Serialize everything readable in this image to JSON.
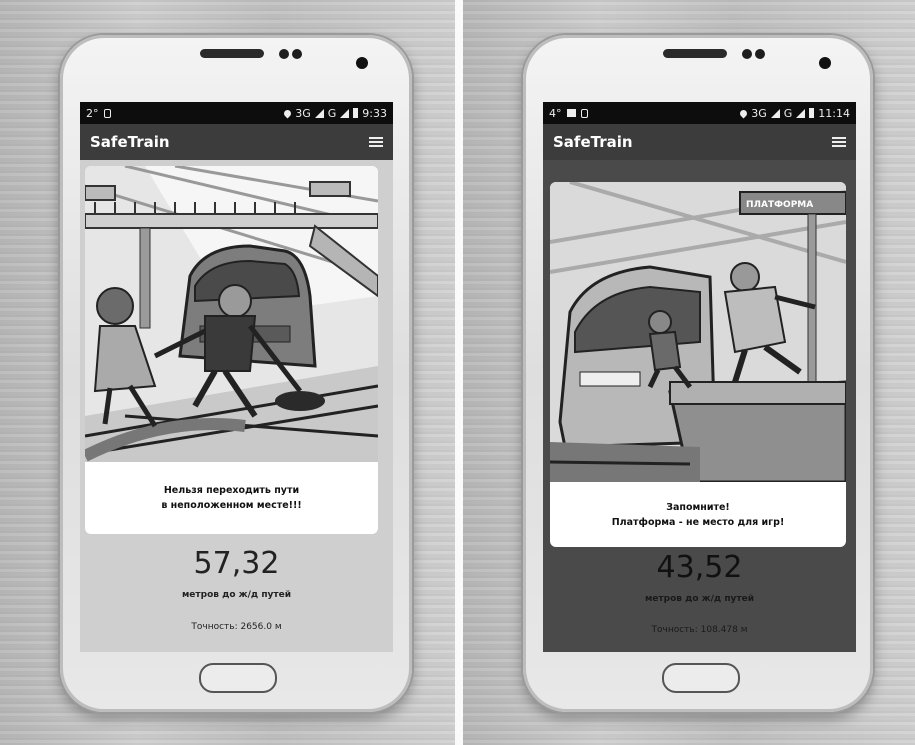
{
  "screens": [
    {
      "status": {
        "temp": "2°",
        "network": "3G",
        "signal": "G",
        "time": "9:33"
      },
      "app_title": "SafeTrain",
      "caption_line1": "Нельзя переходить пути",
      "caption_line2": "в неположенном месте!!!",
      "distance": "57,32",
      "distance_unit": "метров до ж/д путей",
      "accuracy": "Точность: 2656.0 м"
    },
    {
      "status": {
        "temp": "4°",
        "network": "3G",
        "signal": "G",
        "time": "11:14"
      },
      "app_title": "SafeTrain",
      "sign_text": "ПЛАТФОРМА",
      "caption_line1": "Запомните!",
      "caption_line2": "Платформа - не место для игр!",
      "distance": "43,52",
      "distance_unit": "метров до ж/д путей",
      "accuracy": "Точность: 108.478 м"
    }
  ],
  "colors": {
    "statusbar": "#0d0d0d",
    "appbar": "#3c3c3c",
    "screen_bg_left": "#cfcfcf",
    "screen_bg_right": "#4a4a4a"
  }
}
